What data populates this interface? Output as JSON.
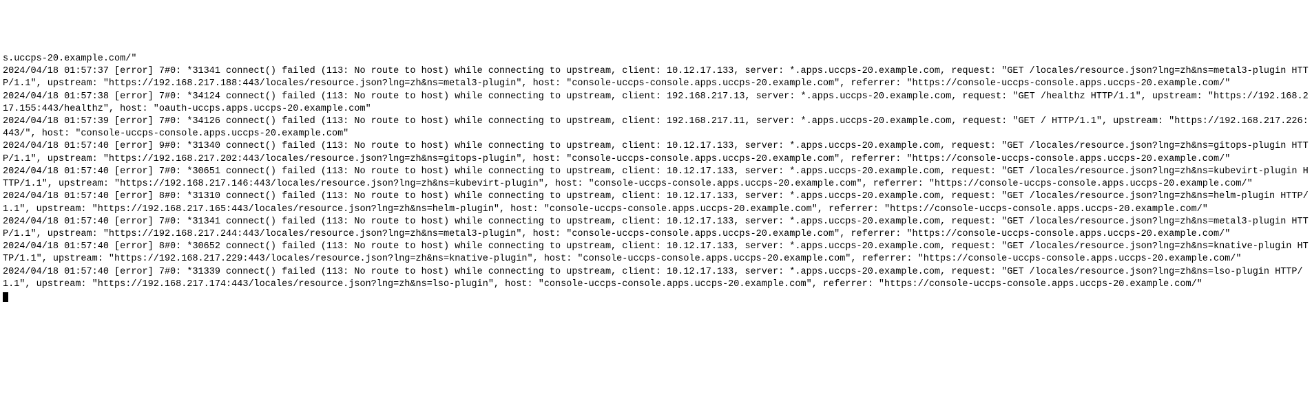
{
  "log": {
    "lines": [
      "s.uccps-20.example.com/\"",
      "2024/04/18 01:57:37 [error] 7#0: *31341 connect() failed (113: No route to host) while connecting to upstream, client: 10.12.17.133, server: *.apps.uccps-20.example.com, request: \"GET /locales/resource.json?lng=zh&ns=metal3-plugin HTTP/1.1\", upstream: \"https://192.168.217.188:443/locales/resource.json?lng=zh&ns=metal3-plugin\", host: \"console-uccps-console.apps.uccps-20.example.com\", referrer: \"https://console-uccps-console.apps.uccps-20.example.com/\"",
      "2024/04/18 01:57:38 [error] 7#0: *34124 connect() failed (113: No route to host) while connecting to upstream, client: 192.168.217.13, server: *.apps.uccps-20.example.com, request: \"GET /healthz HTTP/1.1\", upstream: \"https://192.168.217.155:443/healthz\", host: \"oauth-uccps.apps.uccps-20.example.com\"",
      "2024/04/18 01:57:39 [error] 7#0: *34126 connect() failed (113: No route to host) while connecting to upstream, client: 192.168.217.11, server: *.apps.uccps-20.example.com, request: \"GET / HTTP/1.1\", upstream: \"https://192.168.217.226:443/\", host: \"console-uccps-console.apps.uccps-20.example.com\"",
      "2024/04/18 01:57:40 [error] 9#0: *31340 connect() failed (113: No route to host) while connecting to upstream, client: 10.12.17.133, server: *.apps.uccps-20.example.com, request: \"GET /locales/resource.json?lng=zh&ns=gitops-plugin HTTP/1.1\", upstream: \"https://192.168.217.202:443/locales/resource.json?lng=zh&ns=gitops-plugin\", host: \"console-uccps-console.apps.uccps-20.example.com\", referrer: \"https://console-uccps-console.apps.uccps-20.example.com/\"",
      "2024/04/18 01:57:40 [error] 7#0: *30651 connect() failed (113: No route to host) while connecting to upstream, client: 10.12.17.133, server: *.apps.uccps-20.example.com, request: \"GET /locales/resource.json?lng=zh&ns=kubevirt-plugin HTTP/1.1\", upstream: \"https://192.168.217.146:443/locales/resource.json?lng=zh&ns=kubevirt-plugin\", host: \"console-uccps-console.apps.uccps-20.example.com\", referrer: \"https://console-uccps-console.apps.uccps-20.example.com/\"",
      "2024/04/18 01:57:40 [error] 8#0: *31310 connect() failed (113: No route to host) while connecting to upstream, client: 10.12.17.133, server: *.apps.uccps-20.example.com, request: \"GET /locales/resource.json?lng=zh&ns=helm-plugin HTTP/1.1\", upstream: \"https://192.168.217.165:443/locales/resource.json?lng=zh&ns=helm-plugin\", host: \"console-uccps-console.apps.uccps-20.example.com\", referrer: \"https://console-uccps-console.apps.uccps-20.example.com/\"",
      "2024/04/18 01:57:40 [error] 7#0: *31341 connect() failed (113: No route to host) while connecting to upstream, client: 10.12.17.133, server: *.apps.uccps-20.example.com, request: \"GET /locales/resource.json?lng=zh&ns=metal3-plugin HTTP/1.1\", upstream: \"https://192.168.217.244:443/locales/resource.json?lng=zh&ns=metal3-plugin\", host: \"console-uccps-console.apps.uccps-20.example.com\", referrer: \"https://console-uccps-console.apps.uccps-20.example.com/\"",
      "2024/04/18 01:57:40 [error] 8#0: *30652 connect() failed (113: No route to host) while connecting to upstream, client: 10.12.17.133, server: *.apps.uccps-20.example.com, request: \"GET /locales/resource.json?lng=zh&ns=knative-plugin HTTP/1.1\", upstream: \"https://192.168.217.229:443/locales/resource.json?lng=zh&ns=knative-plugin\", host: \"console-uccps-console.apps.uccps-20.example.com\", referrer: \"https://console-uccps-console.apps.uccps-20.example.com/\"",
      "2024/04/18 01:57:40 [error] 7#0: *31339 connect() failed (113: No route to host) while connecting to upstream, client: 10.12.17.133, server: *.apps.uccps-20.example.com, request: \"GET /locales/resource.json?lng=zh&ns=lso-plugin HTTP/1.1\", upstream: \"https://192.168.217.174:443/locales/resource.json?lng=zh&ns=lso-plugin\", host: \"console-uccps-console.apps.uccps-20.example.com\", referrer: \"https://console-uccps-console.apps.uccps-20.example.com/\""
    ]
  }
}
